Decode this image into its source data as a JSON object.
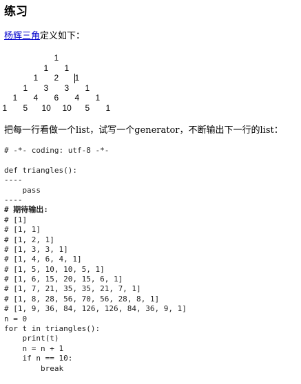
{
  "heading": "练习",
  "intro": {
    "link_text": "杨辉三角",
    "rest_text": "定义如下："
  },
  "triangle_rows": [
    [
      "1"
    ],
    [
      "1",
      "1"
    ],
    [
      "1",
      "2",
      "1"
    ],
    [
      "1",
      "3",
      "3",
      "1"
    ],
    [
      "1",
      "4",
      "6",
      "4",
      "1"
    ],
    [
      "1",
      "5",
      "10",
      "10",
      "5",
      "1"
    ]
  ],
  "task_text": "把每一行看做一个list，试写一个generator，不断输出下一行的list：",
  "code": {
    "coding_line": "# -*- coding: utf-8 -*-",
    "def_line": "def triangles():",
    "sep_top": "----",
    "pass_line": "    pass",
    "sep_bottom": "----",
    "expected_label": "# 期待输出:",
    "expected_lines": [
      "# [1]",
      "# [1, 1]",
      "# [1, 2, 1]",
      "# [1, 3, 3, 1]",
      "# [1, 4, 6, 4, 1]",
      "# [1, 5, 10, 10, 5, 1]",
      "# [1, 6, 15, 20, 15, 6, 1]",
      "# [1, 7, 21, 35, 35, 21, 7, 1]",
      "# [1, 8, 28, 56, 70, 56, 28, 8, 1]",
      "# [1, 9, 36, 84, 126, 126, 84, 36, 9, 1]"
    ],
    "loop_lines": [
      "n = 0",
      "for t in triangles():",
      "    print(t)",
      "    n = n + 1",
      "    if n == 10:",
      "        break"
    ]
  }
}
